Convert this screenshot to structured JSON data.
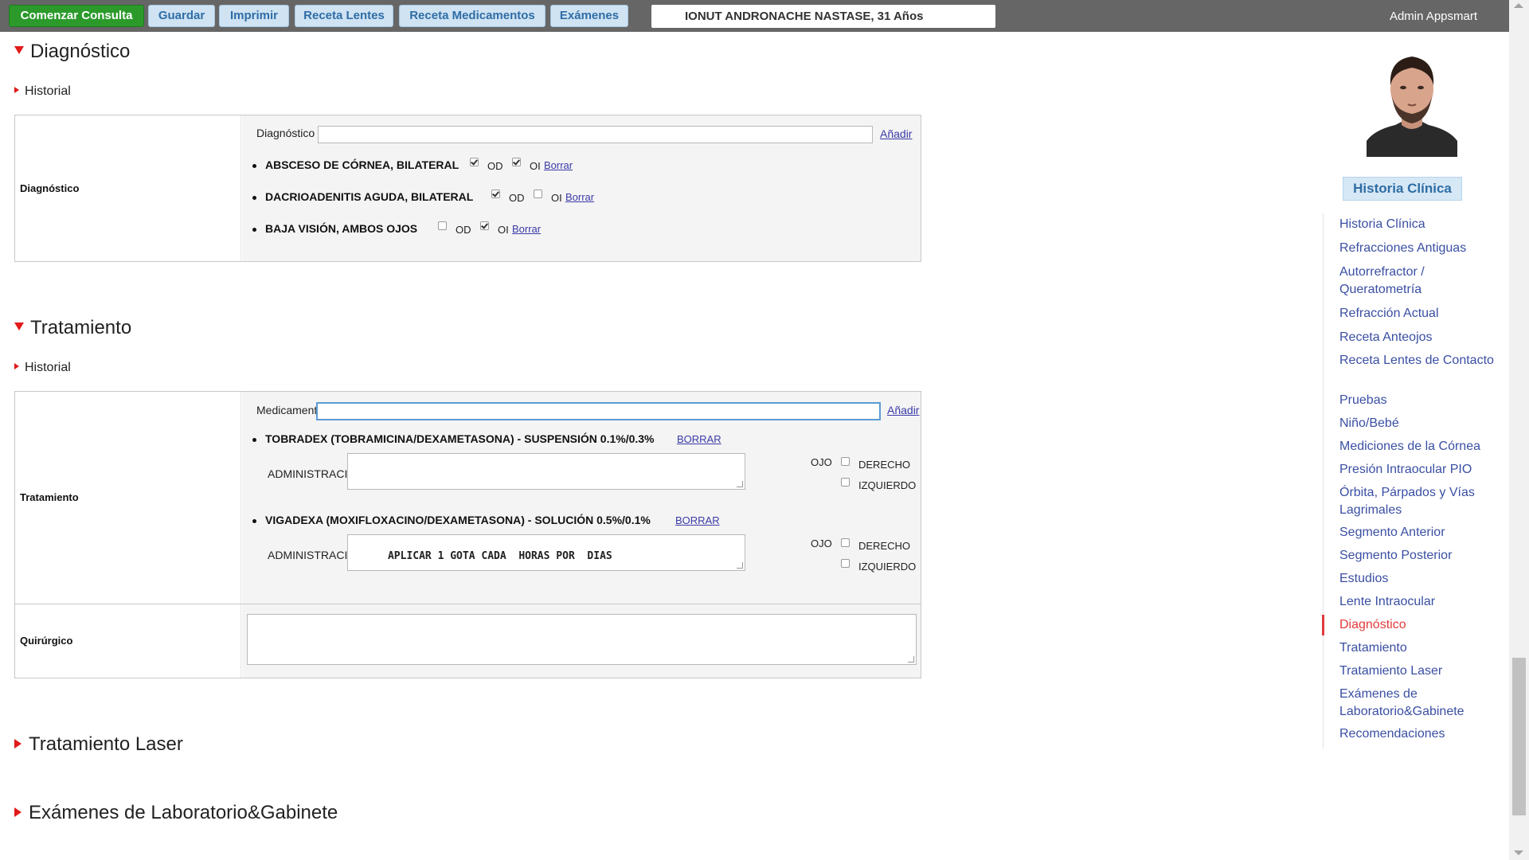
{
  "topbar": {
    "start_label": "Comenzar Consulta",
    "save_label": "Guardar",
    "print_label": "Imprimir",
    "lens_rx_label": "Receta Lentes",
    "med_rx_label": "Receta Medicamentos",
    "exams_label": "Exámenes",
    "patient": "IONUT ANDRONACHE NASTASE, 31 Años",
    "user": "Admin Appsmart"
  },
  "colors": {
    "topbar_bg": "#666666",
    "start_button": "#2b9a2b",
    "light_button": "#cfe3f3",
    "accent_red": "#e21a1a",
    "link_blue": "#3a4fa3"
  },
  "diagnostico": {
    "title": "Diagnóstico",
    "historial": "Historial",
    "row_label": "Diagnóstico",
    "input_label": "Diagnóstico",
    "input_value": "",
    "add_label": "Añadir",
    "items": [
      {
        "name": "ABSCESO DE CÓRNEA, BILATERAL",
        "od_label": "OD",
        "od_checked": true,
        "oi_label": "OI",
        "oi_checked": true,
        "delete_label": "Borrar"
      },
      {
        "name": "DACRIOADENITIS AGUDA, BILATERAL",
        "od_label": "OD",
        "od_checked": true,
        "oi_label": "OI",
        "oi_checked": false,
        "delete_label": "Borrar"
      },
      {
        "name": "BAJA VISIÓN, AMBOS OJOS",
        "od_label": "OD",
        "od_checked": false,
        "oi_label": "OI",
        "oi_checked": true,
        "delete_label": "Borrar"
      }
    ]
  },
  "tratamiento": {
    "title": "Tratamiento",
    "historial": "Historial",
    "row_label": "Tratamiento",
    "input_label": "Medicamento",
    "input_value": "",
    "add_label": "Añadir",
    "meds": [
      {
        "name": "TOBRADEX (TOBRAMICINA/DEXAMETASONA) - SUSPENSIÓN 0.1%/0.3%",
        "delete_label": "BORRAR",
        "admin_label": "ADMINISTRACIÓN",
        "admin_value": "",
        "eye_label": "OJO",
        "right_label": "DERECHO",
        "right_checked": false,
        "left_label": "IZQUIERDO",
        "left_checked": false
      },
      {
        "name": "VIGADEXA (MOXIFLOXACINO/DEXAMETASONA) - SOLUCIÓN 0.5%/0.1%",
        "delete_label": "BORRAR",
        "admin_label": "ADMINISTRACIÓN",
        "admin_value": "APLICAR 1 GOTA CADA  HORAS POR  DIAS",
        "eye_label": "OJO",
        "right_label": "DERECHO",
        "right_checked": false,
        "left_label": "IZQUIERDO",
        "left_checked": false
      }
    ],
    "surgical_label": "Quirúrgico",
    "surgical_value": ""
  },
  "collapsed_sections": [
    {
      "title": "Tratamiento Laser"
    },
    {
      "title": "Exámenes de Laboratorio&Gabinete"
    }
  ],
  "sidebar": {
    "history_button": "Historia Clínica",
    "items": [
      {
        "label": "Historia Clínica"
      },
      {
        "label": "Refracciones Antiguas"
      },
      {
        "label": "Autorrefractor / Queratometría"
      },
      {
        "label": "Refracción Actual"
      },
      {
        "label": "Receta Anteojos"
      },
      {
        "label": "Receta Lentes de Contacto"
      },
      {
        "label": "Pruebas"
      },
      {
        "label": "Niño/Bebé"
      },
      {
        "label": "Mediciones de la Córnea"
      },
      {
        "label": "Presión Intraocular PIO"
      },
      {
        "label": "Órbita, Párpados y Vías Lagrimales"
      },
      {
        "label": "Segmento Anterior"
      },
      {
        "label": "Segmento Posterior"
      },
      {
        "label": "Estudios"
      },
      {
        "label": "Lente Intraocular"
      },
      {
        "label": "Diagnóstico",
        "active": true
      },
      {
        "label": "Tratamiento"
      },
      {
        "label": "Tratamiento Laser"
      },
      {
        "label": "Exámenes de Laboratorio&Gabinete"
      },
      {
        "label": "Recomendaciones"
      }
    ]
  }
}
